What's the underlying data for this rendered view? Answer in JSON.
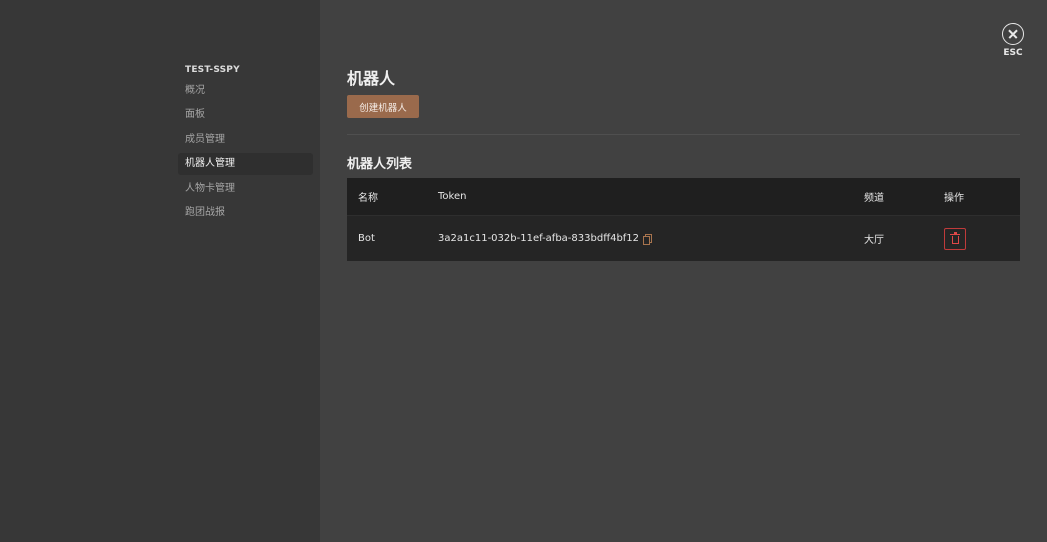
{
  "sidebar": {
    "server_name": "TEST-SSPY",
    "items": [
      {
        "label": "概况",
        "active": false
      },
      {
        "label": "面板",
        "active": false
      },
      {
        "label": "成员管理",
        "active": false
      },
      {
        "label": "机器人管理",
        "active": true
      },
      {
        "label": "人物卡管理",
        "active": false
      },
      {
        "label": "跑团战报",
        "active": false
      }
    ]
  },
  "header": {
    "close_label": "ESC",
    "close_icon": "close-circle-icon"
  },
  "main": {
    "title": "机器人",
    "create_button_label": "创建机器人",
    "list_title": "机器人列表",
    "table": {
      "columns": {
        "name": "名称",
        "token": "Token",
        "channel": "频道",
        "operation": "操作"
      },
      "rows": [
        {
          "name": "Bot",
          "token": "3a2a1c11-032b-11ef-afba-833bdff4bf12",
          "channel": "大厅"
        }
      ]
    }
  },
  "colors": {
    "accent": "#9a6a4c",
    "danger": "#c03b3b",
    "sidebar_bg": "#373737",
    "main_bg": "#414141"
  }
}
